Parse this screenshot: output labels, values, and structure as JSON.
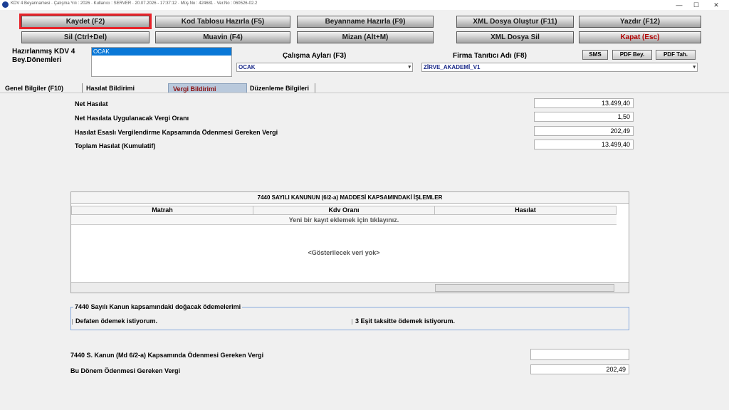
{
  "window": {
    "title": "KDV 4 Beyannamesi  ·  Çalışma Yılı : 2026  ·  Kullanıcı : SERVER  ·  20.07.2026 - 17:37:12  ·  Müş.No : 424681  ·  Ver.No : 060526-02.2",
    "minimize": "—",
    "maximize": "☐",
    "close": "✕"
  },
  "toolbar": {
    "row1": [
      "Kaydet (F2)",
      "Kod Tablosu Hazırla (F5)",
      "Beyanname Hazırla (F9)",
      "XML Dosya Oluştur (F11)",
      "Yazdır (F12)"
    ],
    "row2": [
      "Sil (Ctrl+Del)",
      "Muavin (F4)",
      "Mizan (Alt+M)",
      "XML Dosya Sil",
      "Kapat (Esc)"
    ]
  },
  "periods": {
    "label_line1": "Hazırlanmış KDV 4",
    "label_line2": "Bey.Dönemleri",
    "items": [
      "OCAK"
    ]
  },
  "calisma": {
    "label": "Çalışma Ayları (F3)",
    "value": "OCAK"
  },
  "firma": {
    "label": "Firma Tanıtıcı Adı (F8)",
    "value": "ZİRVE_AKADEMİ_V1"
  },
  "smallButtons": [
    "SMS",
    "PDF Bey.",
    "PDF Tah."
  ],
  "tabs": [
    "Genel Bilgiler (F10)",
    "Hasılat Bildirimi",
    "Vergi Bildirimi",
    "Düzenleme Bilgileri"
  ],
  "fields": [
    {
      "label": "Net Hasılat",
      "value": "13.499,40"
    },
    {
      "label": "Net Hasılata Uygulanacak Vergi Oranı",
      "value": "1,50"
    },
    {
      "label": "Hasılat Esaslı Vergilendirme Kapsamında Ödenmesi Gereken Vergi",
      "value": "202,49"
    },
    {
      "label": "Toplam Hasılat (Kumulatif)",
      "value": "13.499,40"
    }
  ],
  "grid": {
    "title": "7440 SAYILI KANUNUN (6/2-a) MADDESİ KAPSAMINDAKİ İŞLEMLER",
    "columns": [
      "Matrah",
      "Kdv Oranı",
      "Hasılat"
    ],
    "newRow": "Yeni bir kayıt eklemek için tıklayınız.",
    "empty": "<Gösterilecek veri yok>"
  },
  "payment": {
    "title": "7440 Sayılı Kanun kapsamındaki doğacak ödemelerimi",
    "options": [
      "Defaten ödemek istiyorum.",
      "3 Eşit taksitte ödemek istiyorum."
    ]
  },
  "bottom": [
    {
      "label": "7440 S. Kanun (Md 6/2-a) Kapsamında Ödenmesi Gereken Vergi",
      "value": ""
    },
    {
      "label": "Bu Dönem Ödenmesi Gereken Vergi",
      "value": "202,49"
    }
  ]
}
